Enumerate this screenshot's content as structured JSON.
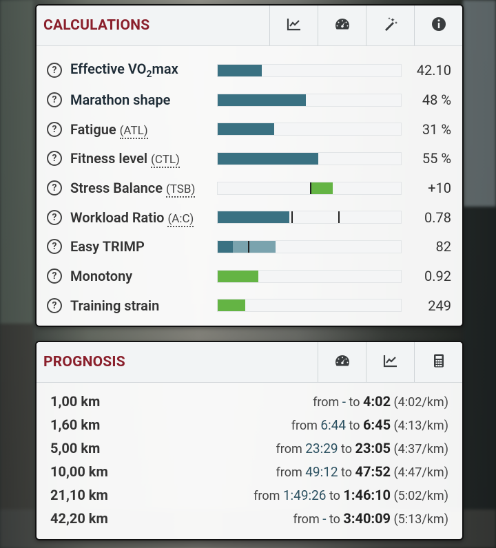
{
  "calculations": {
    "title": "CALCULATIONS",
    "header_buttons": [
      {
        "icon": "line-chart-icon"
      },
      {
        "icon": "speedometer-icon"
      },
      {
        "icon": "magic-wand-icon"
      },
      {
        "icon": "info-icon"
      }
    ],
    "help_glyph": "?",
    "rows": [
      {
        "label": "Effective VO",
        "sub": "2",
        "label_tail": "max",
        "abbr": "",
        "value": "42.10",
        "fill": 0.24
      },
      {
        "label": "Marathon shape",
        "abbr": "",
        "value": "48 %",
        "fill": 0.48
      },
      {
        "label": "Fatigue",
        "abbr": "(ATL)",
        "value": "31 %",
        "fill": 0.31
      },
      {
        "label": "Fitness level",
        "abbr": "(CTL)",
        "value": "55 %",
        "fill": 0.55
      },
      {
        "label": "Stress Balance",
        "abbr": "(TSB)",
        "value": "+10"
      },
      {
        "label": "Workload Ratio",
        "abbr": "(A:C)",
        "value": "0.78",
        "fill": 0.39
      },
      {
        "label": "Easy TRIMP",
        "abbr": "",
        "value": "82"
      },
      {
        "label": "Monotony",
        "abbr": "",
        "value": "0.92",
        "fill": 0.22
      },
      {
        "label": "Training strain",
        "abbr": "",
        "value": "249",
        "fill": 0.15
      }
    ]
  },
  "prognosis": {
    "title": "PROGNOSIS",
    "header_buttons": [
      {
        "icon": "speedometer-icon"
      },
      {
        "icon": "line-chart-icon"
      },
      {
        "icon": "calculator-icon"
      }
    ],
    "from_word": "from",
    "to_word": "to",
    "rows": [
      {
        "distance": "1,00 km",
        "from": "-",
        "to": "4:02",
        "pace": "(4:02/km)"
      },
      {
        "distance": "1,60 km",
        "from": "6:44",
        "to": "6:45",
        "pace": "(4:13/km)"
      },
      {
        "distance": "5,00 km",
        "from": "23:29",
        "to": "23:05",
        "pace": "(4:37/km)"
      },
      {
        "distance": "10,00 km",
        "from": "49:12",
        "to": "47:52",
        "pace": "(4:47/km)"
      },
      {
        "distance": "21,10 km",
        "from": "1:49:26",
        "to": "1:46:10",
        "pace": "(5:02/km)"
      },
      {
        "distance": "42,20 km",
        "from": "-",
        "to": "3:40:09",
        "pace": "(5:13/km)"
      }
    ]
  }
}
